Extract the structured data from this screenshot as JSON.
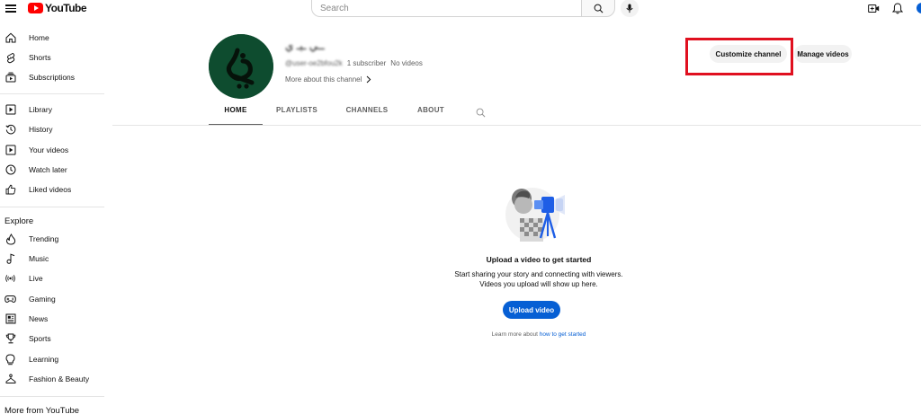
{
  "header": {
    "logo_text": "YouTube",
    "search_placeholder": "Search"
  },
  "sidebar": {
    "main": [
      {
        "label": "Home",
        "icon": "home-icon"
      },
      {
        "label": "Shorts",
        "icon": "shorts-icon"
      },
      {
        "label": "Subscriptions",
        "icon": "subscriptions-icon"
      }
    ],
    "library": [
      {
        "label": "Library",
        "icon": "library-icon"
      },
      {
        "label": "History",
        "icon": "history-icon"
      },
      {
        "label": "Your videos",
        "icon": "your-videos-icon"
      },
      {
        "label": "Watch later",
        "icon": "watch-later-icon"
      },
      {
        "label": "Liked videos",
        "icon": "liked-videos-icon"
      }
    ],
    "explore_title": "Explore",
    "explore": [
      {
        "label": "Trending",
        "icon": "trending-icon"
      },
      {
        "label": "Music",
        "icon": "music-icon"
      },
      {
        "label": "Live",
        "icon": "live-icon"
      },
      {
        "label": "Gaming",
        "icon": "gaming-icon"
      },
      {
        "label": "News",
        "icon": "news-icon"
      },
      {
        "label": "Sports",
        "icon": "sports-icon"
      },
      {
        "label": "Learning",
        "icon": "learning-icon"
      },
      {
        "label": "Fashion & Beauty",
        "icon": "fashion-icon"
      }
    ],
    "more_title": "More from YouTube"
  },
  "channel": {
    "name": "ــي ـيـ ي",
    "handle": "@user-oe2bfou2k",
    "subscribers": "1 subscriber",
    "videos": "No videos",
    "more_about": "More about this channel",
    "customize_label": "Customize channel",
    "manage_label": "Manage videos"
  },
  "tabs": [
    {
      "label": "HOME",
      "active": true
    },
    {
      "label": "PLAYLISTS",
      "active": false
    },
    {
      "label": "CHANNELS",
      "active": false
    },
    {
      "label": "ABOUT",
      "active": false
    }
  ],
  "empty_state": {
    "title": "Upload a video to get started",
    "description": "Start sharing your story and connecting with viewers. Videos you upload will show up here.",
    "upload_label": "Upload video",
    "learn_prefix": "Learn more about",
    "learn_link": "how to get started"
  },
  "colors": {
    "brand_red": "#ff0000",
    "accent_blue": "#065fd4",
    "highlight_red": "#e0101f",
    "avatar_green": "#0e4c2f"
  }
}
